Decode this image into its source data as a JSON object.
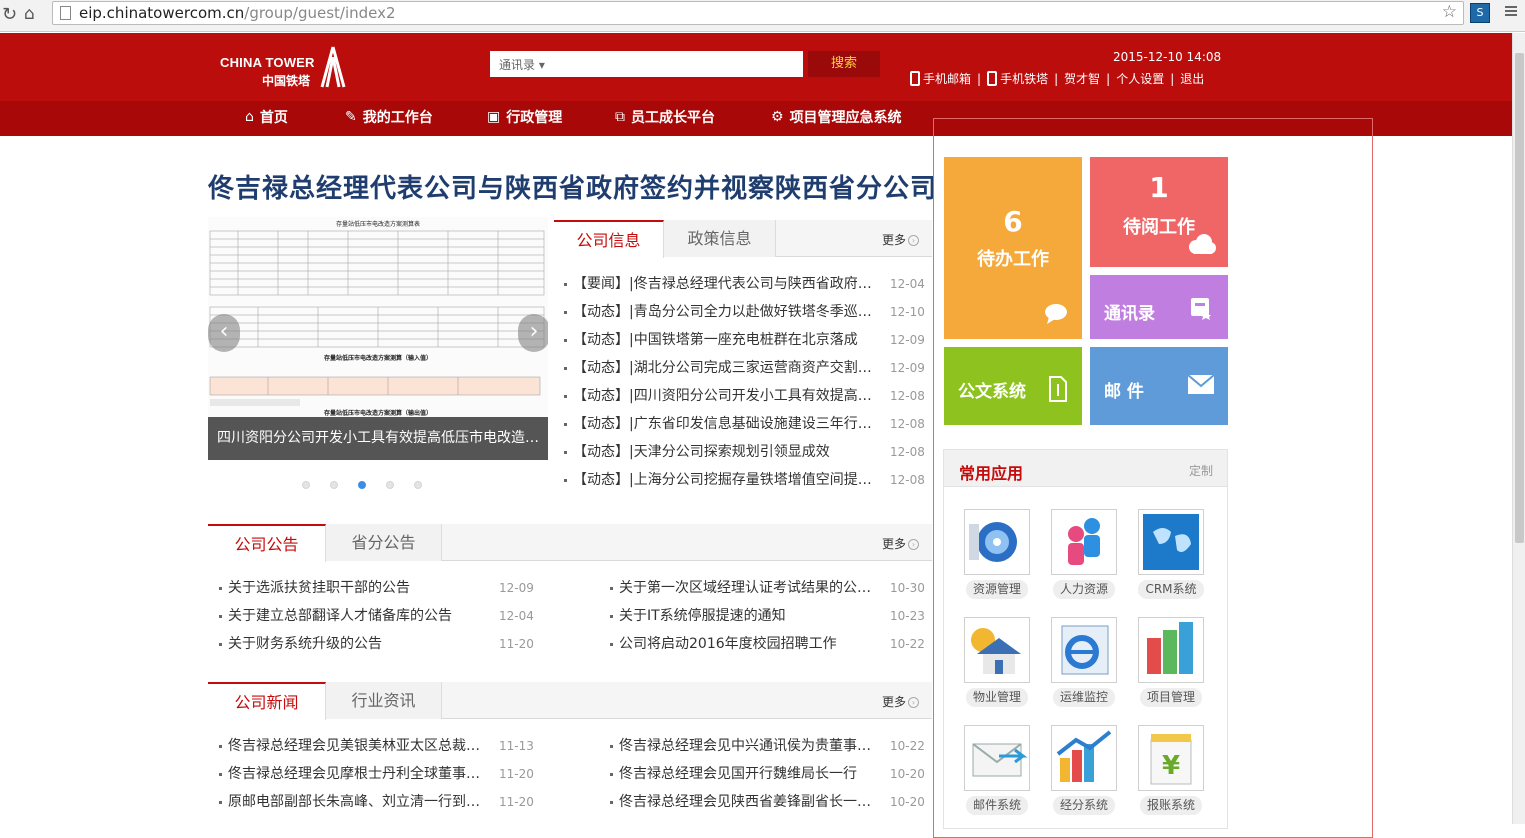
{
  "browser": {
    "url_host": "eip.chinatowercom.cn",
    "url_path": "/group/guest/index2"
  },
  "header": {
    "logo_en": "CHINA TOWER",
    "logo_cn": "中国铁塔",
    "search_select": "通讯录 ▾",
    "search_placeholder": "",
    "search_button": "搜索",
    "datetime": "2015-12-10 14:08",
    "links": [
      "手机邮箱",
      "手机铁塔",
      "贺才智",
      "个人设置",
      "退出"
    ]
  },
  "nav": [
    {
      "label": "首页",
      "icon": "home-icon"
    },
    {
      "label": "我的工作台",
      "icon": "edit-icon"
    },
    {
      "label": "行政管理",
      "icon": "briefcase-icon"
    },
    {
      "label": "员工成长平台",
      "icon": "window-icon"
    },
    {
      "label": "项目管理应急系统",
      "icon": "gear-icon"
    }
  ],
  "headline": "佟吉禄总经理代表公司与陕西省政府签约并视察陕西省分公司",
  "slider": {
    "caption": "四川资阳分公司开发小工具有效提高低压市电改造…",
    "doc_title": "存量站低压市电改造方案测算表",
    "doc_sub1": "存量站低压市电改造方案测算（输入值）",
    "doc_sub2": "存量站低压市电改造方案测算（输出值）"
  },
  "info_tabs": {
    "tabs": [
      "公司信息",
      "政策信息"
    ],
    "more": "更多",
    "items": [
      {
        "text": "【要闻】|佟吉禄总经理代表公司与陕西省政府…",
        "date": "12-04"
      },
      {
        "text": "【动态】|青岛分公司全力以赴做好铁塔冬季巡…",
        "date": "12-10"
      },
      {
        "text": "【动态】|中国铁塔第一座充电桩群在北京落成",
        "date": "12-09"
      },
      {
        "text": "【动态】|湖北分公司完成三家运营商资产交割…",
        "date": "12-09"
      },
      {
        "text": "【动态】|四川资阳分公司开发小工具有效提高…",
        "date": "12-08"
      },
      {
        "text": "【动态】|广东省印发信息基础设施建设三年行…",
        "date": "12-08"
      },
      {
        "text": "【动态】|天津分公司探索规划引领显成效",
        "date": "12-08"
      },
      {
        "text": "【动态】|上海分公司挖掘存量铁塔增值空间提…",
        "date": "12-08"
      }
    ]
  },
  "notice": {
    "tabs": [
      "公司公告",
      "省分公告"
    ],
    "more": "更多",
    "left": [
      {
        "text": "关于选派扶贫挂职干部的公告",
        "date": "12-09"
      },
      {
        "text": "关于建立总部翻译人才储备库的公告",
        "date": "12-04"
      },
      {
        "text": "关于财务系统升级的公告",
        "date": "11-20"
      }
    ],
    "right": [
      {
        "text": "关于第一次区域经理认证考试结果的公…",
        "date": "10-30"
      },
      {
        "text": "关于IT系统停服提速的通知",
        "date": "10-23"
      },
      {
        "text": "公司将启动2016年度校园招聘工作",
        "date": "10-22"
      }
    ]
  },
  "news": {
    "tabs": [
      "公司新闻",
      "行业资讯"
    ],
    "more": "更多",
    "left": [
      {
        "text": "佟吉禄总经理会见美银美林亚太区总裁…",
        "date": "11-13"
      },
      {
        "text": "佟吉禄总经理会见摩根士丹利全球董事…",
        "date": "11-20"
      },
      {
        "text": "原邮电部副部长朱高峰、刘立清一行到…",
        "date": "11-20"
      }
    ],
    "right": [
      {
        "text": "佟吉禄总经理会见中兴通讯侯为贵董事…",
        "date": "10-22"
      },
      {
        "text": "佟吉禄总经理会见国开行魏维局长一行",
        "date": "10-20"
      },
      {
        "text": "佟吉禄总经理会见陕西省姜锋副省长一…",
        "date": "10-20"
      }
    ]
  },
  "tiles": {
    "todo": {
      "count": "6",
      "label": "待办工作",
      "color": "#f5a93a"
    },
    "toread": {
      "count": "1",
      "label": "待阅工作",
      "color": "#f06666"
    },
    "contacts": {
      "label": "通讯录",
      "color": "#c07ee0"
    },
    "docs": {
      "label": "公文系统",
      "color": "#8dc21f"
    },
    "mail": {
      "label": "邮 件",
      "color": "#5e9bd8"
    }
  },
  "apps": {
    "title": "常用应用",
    "customize": "定制",
    "items": [
      {
        "label": "资源管理",
        "icon": "disk-icon"
      },
      {
        "label": "人力资源",
        "icon": "people-icon"
      },
      {
        "label": "CRM系统",
        "icon": "globe-icon"
      },
      {
        "label": "物业管理",
        "icon": "house-icon"
      },
      {
        "label": "运维监控",
        "icon": "ie-icon"
      },
      {
        "label": "项目管理",
        "icon": "chart-icon"
      },
      {
        "label": "邮件系统",
        "icon": "envelope-icon"
      },
      {
        "label": "经分系统",
        "icon": "bar-chart-icon"
      },
      {
        "label": "报账系统",
        "icon": "yen-icon"
      }
    ]
  }
}
